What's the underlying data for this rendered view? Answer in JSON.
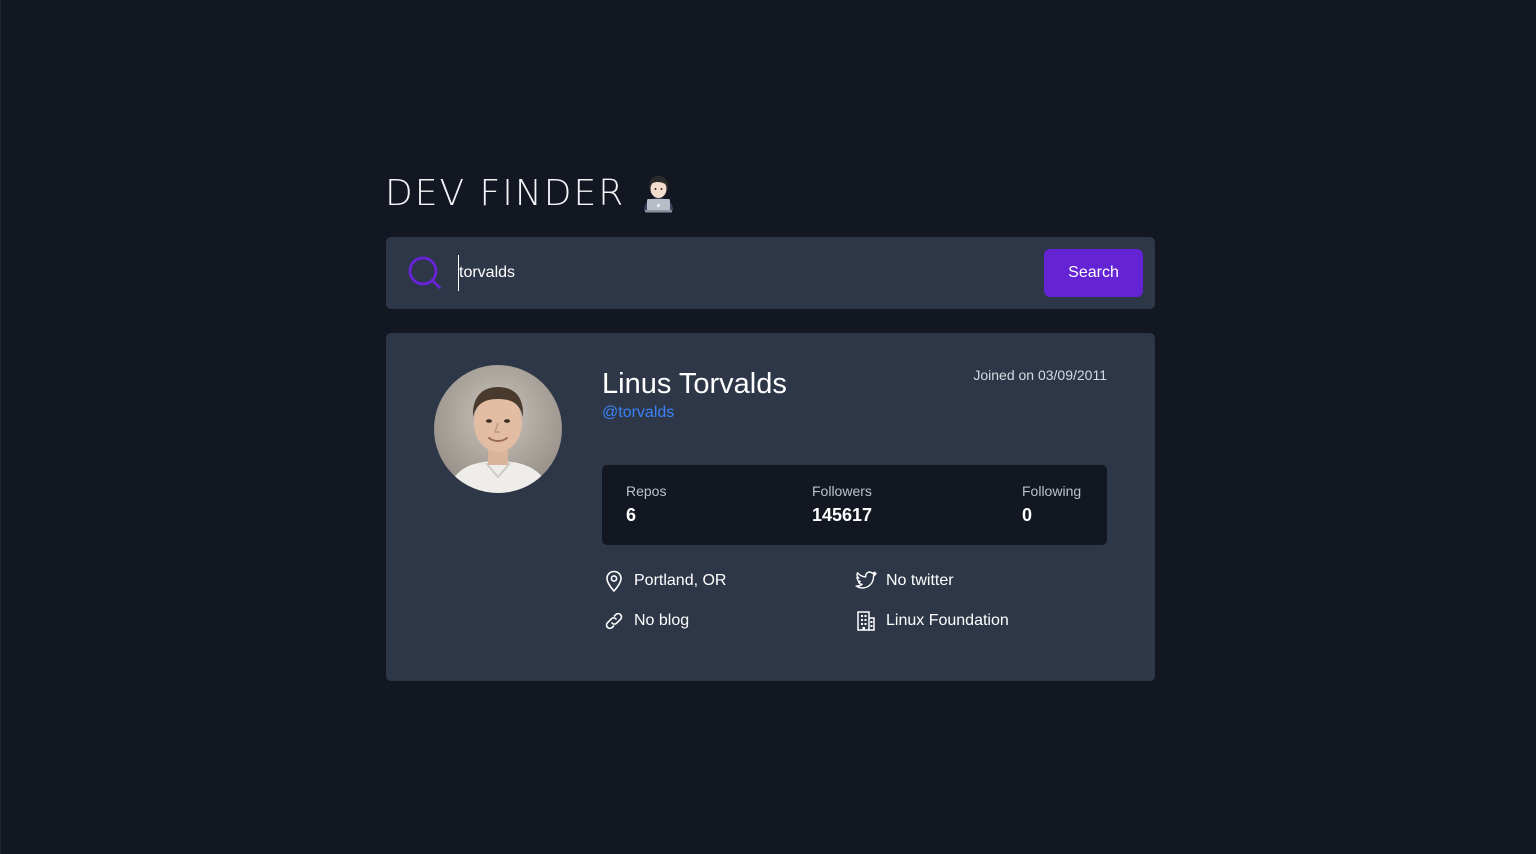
{
  "header": {
    "title": "DEV FINDER"
  },
  "search": {
    "value": "torvalds",
    "button_label": "Search"
  },
  "profile": {
    "name": "Linus Torvalds",
    "handle": "@torvalds",
    "joined": "Joined on 03/09/2011",
    "stats": [
      {
        "label": "Repos",
        "value": "6"
      },
      {
        "label": "Followers",
        "value": "145617"
      },
      {
        "label": "Following",
        "value": "0"
      }
    ],
    "info": {
      "location": "Portland, OR",
      "twitter": "No twitter",
      "blog": "No blog",
      "company": "Linux Foundation"
    }
  },
  "icons": {
    "title_emoji": "technologist-icon",
    "search": "search-icon",
    "location": "map-pin-icon",
    "twitter": "twitter-icon",
    "blog": "link-icon",
    "company": "building-icon"
  },
  "colors": {
    "background": "#131722",
    "card": "#2e3747",
    "accent": "#6424d4",
    "link": "#3b82f6"
  }
}
